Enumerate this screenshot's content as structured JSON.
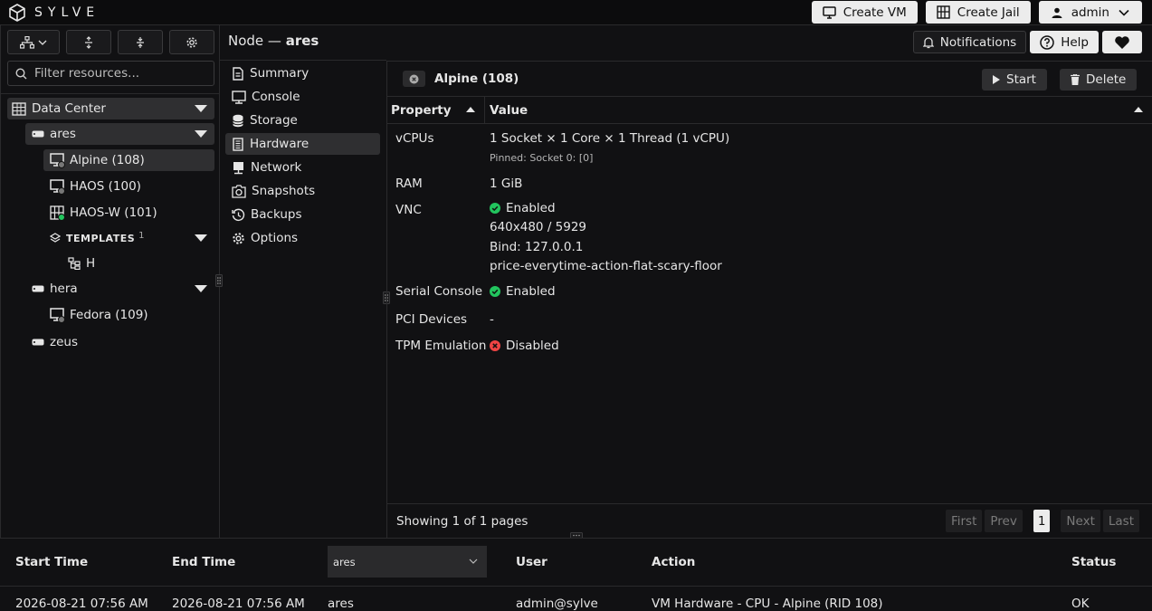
{
  "app": {
    "name": "SYLVE"
  },
  "topbar": {
    "create_vm": "Create VM",
    "create_jail": "Create Jail",
    "user": "admin"
  },
  "sidebar": {
    "filter_placeholder": "Filter resources...",
    "tree": {
      "datacenter": "Data Center",
      "nodes": [
        {
          "name": "ares",
          "vms": [
            "Alpine (108)",
            "HAOS (100)",
            "HAOS-W (101)"
          ],
          "templates_label": "TEMPLATES",
          "templates_count": "1",
          "templates": [
            "H"
          ]
        },
        {
          "name": "hera",
          "vms": [
            "Fedora (109)"
          ]
        },
        {
          "name": "zeus"
        }
      ]
    }
  },
  "header": {
    "title_prefix": "Node —",
    "title_node": "ares",
    "notifications": "Notifications",
    "help": "Help"
  },
  "menu": [
    "Summary",
    "Console",
    "Storage",
    "Hardware",
    "Network",
    "Snapshots",
    "Backups",
    "Options"
  ],
  "panel": {
    "vm_title": "Alpine (108)",
    "start": "Start",
    "delete": "Delete",
    "col_property": "Property",
    "col_value": "Value",
    "rows": {
      "vcpus": {
        "name": "vCPUs",
        "value": "1 Socket × 1 Core × 1 Thread (1 vCPU)",
        "sub": "Pinned: Socket 0: [0]"
      },
      "ram": {
        "name": "RAM",
        "value": "1 GiB"
      },
      "vnc": {
        "name": "VNC",
        "status": "Enabled",
        "resolution": "640x480 / 5929",
        "bind": "Bind: 127.0.0.1",
        "password": "price-everytime-action-flat-scary-floor"
      },
      "serial": {
        "name": "Serial Console",
        "status": "Enabled"
      },
      "pci": {
        "name": "PCI Devices",
        "value": "-"
      },
      "tpm": {
        "name": "TPM Emulation",
        "status": "Disabled"
      }
    },
    "showing": "Showing 1 of 1 pages",
    "pager": {
      "first": "First",
      "prev": "Prev",
      "current": "1",
      "next": "Next",
      "last": "Last"
    }
  },
  "log": {
    "headers": {
      "start": "Start Time",
      "end": "End Time",
      "node_filter": "ares",
      "user": "User",
      "action": "Action",
      "status": "Status"
    },
    "row": {
      "start": "2026-08-21 07:56 AM",
      "end": "2026-08-21 07:56 AM",
      "node": "ares",
      "user": "admin@sylve",
      "action": "VM Hardware - CPU - Alpine (RID 108)",
      "status": "OK"
    }
  },
  "colors": {
    "enabled": "#22c55e",
    "disabled": "#ef4444",
    "running": "#22c55e",
    "stopped": "#777777"
  }
}
